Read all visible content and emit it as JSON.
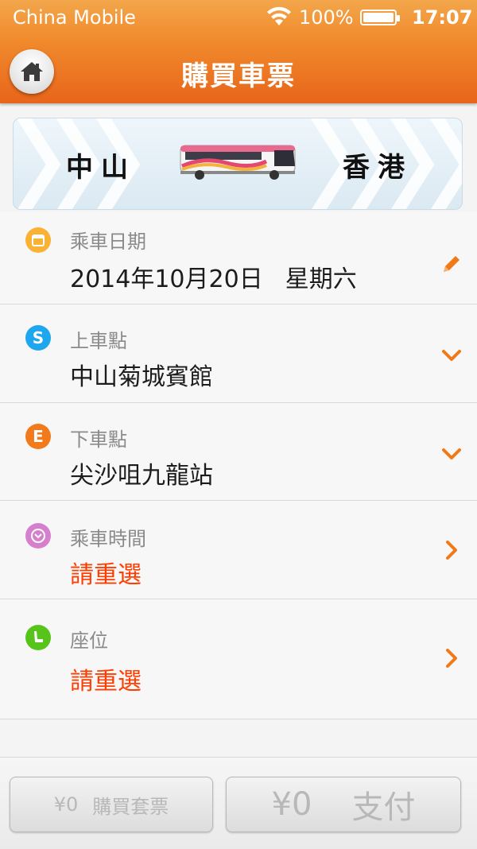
{
  "status": {
    "carrier": "China Mobile",
    "battery": "100%",
    "time": "17:07"
  },
  "header": {
    "title": "購買車票",
    "home_icon": "home-icon"
  },
  "route": {
    "from": "中山",
    "to": "香港",
    "bus_icon": "bus-icon"
  },
  "rows": [
    {
      "label": "乘車日期",
      "value_date": "2014年10月20日",
      "value_day": "星期六",
      "icon": "calendar-icon",
      "action": "edit-icon",
      "color": "#f9b233"
    },
    {
      "label": "上車點",
      "value": "中山菊城賓館",
      "icon": "start-icon",
      "icon_text": "S",
      "action": "chevron-down-icon",
      "color": "#1ea6ee"
    },
    {
      "label": "下車點",
      "value": "尖沙咀九龍站",
      "icon": "end-icon",
      "icon_text": "E",
      "action": "chevron-down-icon",
      "color": "#f27a1b"
    },
    {
      "label": "乘車時間",
      "value": "請重選",
      "icon": "clock-icon",
      "action": "chevron-right-icon",
      "color": "#d77fcf"
    },
    {
      "label": "座位",
      "value": "請重選",
      "icon": "seat-icon",
      "action": "chevron-right-icon",
      "color": "#56c41b"
    }
  ],
  "footer": {
    "package_price": "¥0",
    "package_label": "購買套票",
    "pay_price": "¥0",
    "pay_label": "支付"
  },
  "colors": {
    "accent": "#f08a2c",
    "alert": "#ff3d00",
    "arrow": "#f07a18"
  }
}
